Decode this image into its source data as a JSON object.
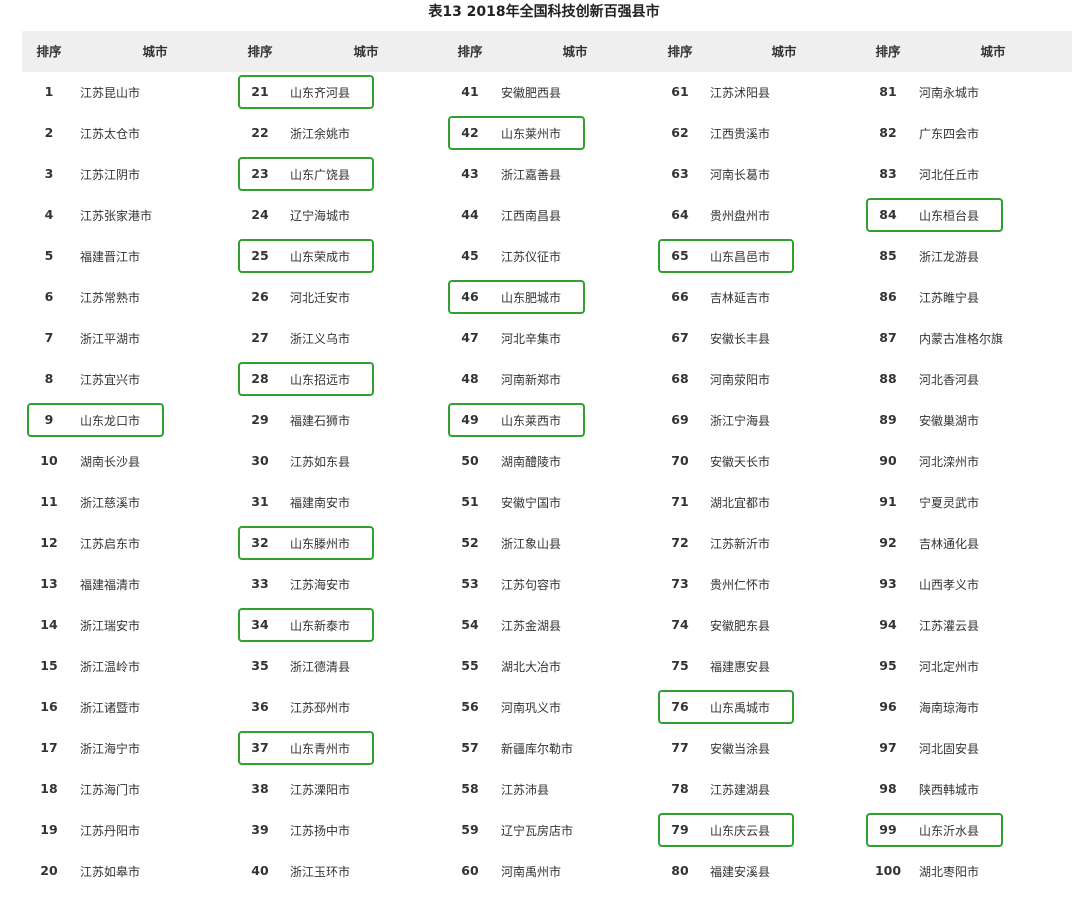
{
  "title": "表13 2018年全国科技创新百强县市",
  "table": {
    "headers": [
      "排序",
      "城市",
      "排序",
      "城市",
      "排序",
      "城市",
      "排序",
      "城市",
      "排序",
      "城市"
    ],
    "columns": [
      [
        {
          "rank": "1",
          "city": "江苏昆山市"
        },
        {
          "rank": "2",
          "city": "江苏太仓市"
        },
        {
          "rank": "3",
          "city": "江苏江阴市"
        },
        {
          "rank": "4",
          "city": "江苏张家港市"
        },
        {
          "rank": "5",
          "city": "福建晋江市"
        },
        {
          "rank": "6",
          "city": "江苏常熟市"
        },
        {
          "rank": "7",
          "city": "浙江平湖市"
        },
        {
          "rank": "8",
          "city": "江苏宜兴市"
        },
        {
          "rank": "9",
          "city": "山东龙口市",
          "highlight": true
        },
        {
          "rank": "10",
          "city": "湖南长沙县"
        },
        {
          "rank": "11",
          "city": "浙江慈溪市"
        },
        {
          "rank": "12",
          "city": "江苏启东市"
        },
        {
          "rank": "13",
          "city": "福建福清市"
        },
        {
          "rank": "14",
          "city": "浙江瑞安市"
        },
        {
          "rank": "15",
          "city": "浙江温岭市"
        },
        {
          "rank": "16",
          "city": "浙江诸暨市"
        },
        {
          "rank": "17",
          "city": "浙江海宁市"
        },
        {
          "rank": "18",
          "city": "江苏海门市"
        },
        {
          "rank": "19",
          "city": "江苏丹阳市"
        },
        {
          "rank": "20",
          "city": "江苏如皋市"
        }
      ],
      [
        {
          "rank": "21",
          "city": "山东齐河县",
          "highlight": true
        },
        {
          "rank": "22",
          "city": "浙江余姚市"
        },
        {
          "rank": "23",
          "city": "山东广饶县",
          "highlight": true
        },
        {
          "rank": "24",
          "city": "辽宁海城市"
        },
        {
          "rank": "25",
          "city": "山东荣成市",
          "highlight": true
        },
        {
          "rank": "26",
          "city": "河北迁安市"
        },
        {
          "rank": "27",
          "city": "浙江义乌市"
        },
        {
          "rank": "28",
          "city": "山东招远市",
          "highlight": true
        },
        {
          "rank": "29",
          "city": "福建石狮市"
        },
        {
          "rank": "30",
          "city": "江苏如东县"
        },
        {
          "rank": "31",
          "city": "福建南安市"
        },
        {
          "rank": "32",
          "city": "山东滕州市",
          "highlight": true
        },
        {
          "rank": "33",
          "city": "江苏海安市"
        },
        {
          "rank": "34",
          "city": "山东新泰市",
          "highlight": true
        },
        {
          "rank": "35",
          "city": "浙江德清县"
        },
        {
          "rank": "36",
          "city": "江苏邳州市"
        },
        {
          "rank": "37",
          "city": "山东青州市",
          "highlight": true
        },
        {
          "rank": "38",
          "city": "江苏溧阳市"
        },
        {
          "rank": "39",
          "city": "江苏扬中市"
        },
        {
          "rank": "40",
          "city": "浙江玉环市"
        }
      ],
      [
        {
          "rank": "41",
          "city": "安徽肥西县"
        },
        {
          "rank": "42",
          "city": "山东莱州市",
          "highlight": true
        },
        {
          "rank": "43",
          "city": "浙江嘉善县"
        },
        {
          "rank": "44",
          "city": "江西南昌县"
        },
        {
          "rank": "45",
          "city": "江苏仪征市"
        },
        {
          "rank": "46",
          "city": "山东肥城市",
          "highlight": true
        },
        {
          "rank": "47",
          "city": "河北辛集市"
        },
        {
          "rank": "48",
          "city": "河南新郑市"
        },
        {
          "rank": "49",
          "city": "山东莱西市",
          "highlight": true
        },
        {
          "rank": "50",
          "city": "湖南醴陵市"
        },
        {
          "rank": "51",
          "city": "安徽宁国市"
        },
        {
          "rank": "52",
          "city": "浙江象山县"
        },
        {
          "rank": "53",
          "city": "江苏句容市"
        },
        {
          "rank": "54",
          "city": "江苏金湖县"
        },
        {
          "rank": "55",
          "city": "湖北大冶市"
        },
        {
          "rank": "56",
          "city": "河南巩义市"
        },
        {
          "rank": "57",
          "city": "新疆库尔勒市"
        },
        {
          "rank": "58",
          "city": "江苏沛县"
        },
        {
          "rank": "59",
          "city": "辽宁瓦房店市"
        },
        {
          "rank": "60",
          "city": "河南禹州市"
        }
      ],
      [
        {
          "rank": "61",
          "city": "江苏沭阳县"
        },
        {
          "rank": "62",
          "city": "江西贵溪市"
        },
        {
          "rank": "63",
          "city": "河南长葛市"
        },
        {
          "rank": "64",
          "city": "贵州盘州市"
        },
        {
          "rank": "65",
          "city": "山东昌邑市",
          "highlight": true
        },
        {
          "rank": "66",
          "city": "吉林延吉市"
        },
        {
          "rank": "67",
          "city": "安徽长丰县"
        },
        {
          "rank": "68",
          "city": "河南荥阳市"
        },
        {
          "rank": "69",
          "city": "浙江宁海县"
        },
        {
          "rank": "70",
          "city": "安徽天长市"
        },
        {
          "rank": "71",
          "city": "湖北宜都市"
        },
        {
          "rank": "72",
          "city": "江苏新沂市"
        },
        {
          "rank": "73",
          "city": "贵州仁怀市"
        },
        {
          "rank": "74",
          "city": "安徽肥东县"
        },
        {
          "rank": "75",
          "city": "福建惠安县"
        },
        {
          "rank": "76",
          "city": "山东禹城市",
          "highlight": true
        },
        {
          "rank": "77",
          "city": "安徽当涂县"
        },
        {
          "rank": "78",
          "city": "江苏建湖县"
        },
        {
          "rank": "79",
          "city": "山东庆云县",
          "highlight": true
        },
        {
          "rank": "80",
          "city": "福建安溪县"
        }
      ],
      [
        {
          "rank": "81",
          "city": "河南永城市"
        },
        {
          "rank": "82",
          "city": "广东四会市"
        },
        {
          "rank": "83",
          "city": "河北任丘市"
        },
        {
          "rank": "84",
          "city": "山东桓台县",
          "highlight": true
        },
        {
          "rank": "85",
          "city": "浙江龙游县"
        },
        {
          "rank": "86",
          "city": "江苏睢宁县"
        },
        {
          "rank": "87",
          "city": "内蒙古准格尔旗"
        },
        {
          "rank": "88",
          "city": "河北香河县"
        },
        {
          "rank": "89",
          "city": "安徽巢湖市"
        },
        {
          "rank": "90",
          "city": "河北滦州市"
        },
        {
          "rank": "91",
          "city": "宁夏灵武市"
        },
        {
          "rank": "92",
          "city": "吉林通化县"
        },
        {
          "rank": "93",
          "city": "山西孝义市"
        },
        {
          "rank": "94",
          "city": "江苏灌云县"
        },
        {
          "rank": "95",
          "city": "河北定州市"
        },
        {
          "rank": "96",
          "city": "海南琼海市"
        },
        {
          "rank": "97",
          "city": "河北固安县"
        },
        {
          "rank": "98",
          "city": "陕西韩城市"
        },
        {
          "rank": "99",
          "city": "山东沂水县",
          "highlight": true
        },
        {
          "rank": "100",
          "city": "湖北枣阳市"
        }
      ]
    ]
  },
  "colors": {
    "highlight_border": "#2fa12f",
    "header_bg": "#efefef",
    "text": "#333333"
  }
}
